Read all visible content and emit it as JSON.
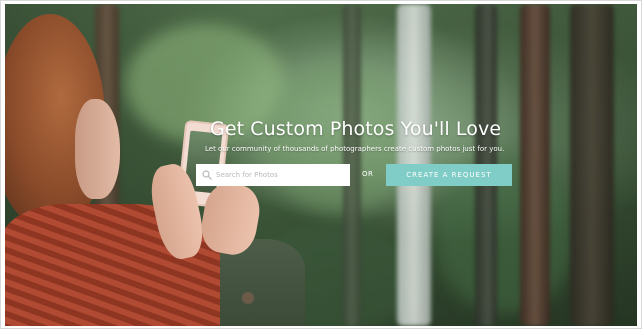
{
  "hero": {
    "headline": "Get Custom Photos You'll Love",
    "subheadline": "Let our community of thousands of photographers create custom photos just for you."
  },
  "search": {
    "placeholder": "Search for Photos",
    "value": "",
    "icon": "search-icon"
  },
  "or_label": "OR",
  "cta": {
    "label": "CREATE A REQUEST",
    "color": "#7fcdc6"
  }
}
